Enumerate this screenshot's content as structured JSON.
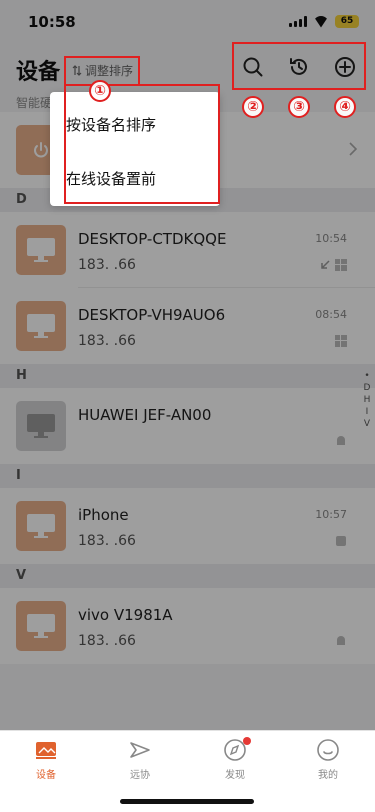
{
  "status": {
    "time": "10:58",
    "battery": "65"
  },
  "header": {
    "title": "设备",
    "sort_label": "调整排序",
    "sort_icon": "sort-arrows-icon"
  },
  "subtitle": "智能硬",
  "sort_menu": {
    "items": [
      "按设备名排序",
      "在线设备置前"
    ]
  },
  "sections": {
    "d": "D",
    "h": "H",
    "i": "I",
    "v": "V"
  },
  "devices": [
    {
      "name": "DESKTOP-CTDKQQE",
      "ip": "183.          .66",
      "time": "10:54"
    },
    {
      "name": "DESKTOP-VH9AUO6",
      "ip": "183.          .66",
      "time": "08:54"
    },
    {
      "name": "HUAWEI JEF-AN00",
      "ip": "",
      "time": ""
    },
    {
      "name": "iPhone",
      "ip": "183.          .66",
      "time": "10:57"
    },
    {
      "name": "vivo V1981A",
      "ip": "183.          .66",
      "time": ""
    }
  ],
  "alpha_index": [
    "•",
    "D",
    "H",
    "I",
    "V"
  ],
  "annotations": [
    "①",
    "②",
    "③",
    "④"
  ],
  "tabs": [
    {
      "label": "设备",
      "icon": "device-icon",
      "active": true
    },
    {
      "label": "远协",
      "icon": "remote-assist-icon",
      "active": false
    },
    {
      "label": "发现",
      "icon": "compass-icon",
      "active": false
    },
    {
      "label": "我的",
      "icon": "profile-icon",
      "active": false
    }
  ],
  "colors": {
    "accent": "#e0622e",
    "thumb_orange": "#e9b08c",
    "annotation": "#e02020"
  }
}
